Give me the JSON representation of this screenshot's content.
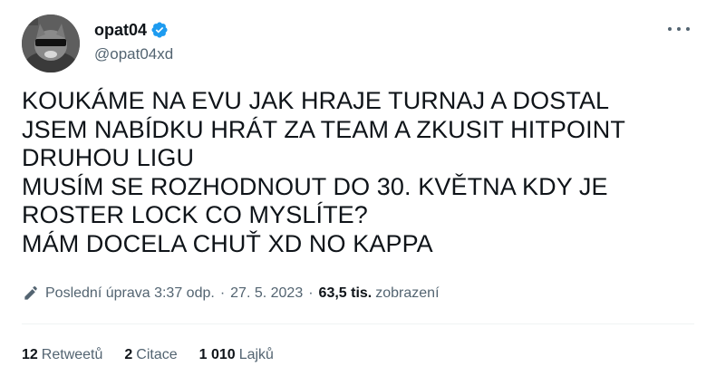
{
  "author": {
    "display_name": "opat04",
    "handle": "@opat04xd",
    "verified": true
  },
  "tweet": {
    "lines": [
      "KOUKÁME NA EVU JAK HRAJE TURNAJ A DOSTAL",
      "JSEM NABÍDKU HRÁT ZA TEAM A ZKUSIT HITPOINT",
      "DRUHOU LIGU",
      "MUSÍM SE ROZHODNOUT DO 30. KVĚTNA KDY JE",
      "ROSTER LOCK CO MYSLÍTE?",
      "MÁM DOCELA CHUŤ XD NO KAPPA"
    ]
  },
  "meta": {
    "edited_label": "Poslední úprava 3:37 odp.",
    "separator": "·",
    "date": "27. 5. 2023",
    "views_count": "63,5 tis.",
    "views_label": "zobrazení"
  },
  "stats": {
    "retweets_count": "12",
    "retweets_label": "Retweetů",
    "quotes_count": "2",
    "quotes_label": "Citace",
    "likes_count": "1 010",
    "likes_label": "Lajků"
  },
  "colors": {
    "text_primary": "#0f1419",
    "text_secondary": "#536471",
    "verified_blue": "#1d9bf0",
    "divider": "#eff3f4"
  },
  "icons": {
    "verified": "verified-badge-icon",
    "more": "more-options-icon",
    "edit": "pencil-icon"
  }
}
